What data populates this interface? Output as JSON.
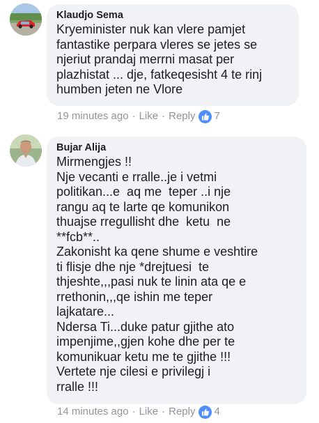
{
  "comments": [
    {
      "author": "Klaudjo Sema",
      "lines": [
        "Kryeminister nuk kan vlere pamjet",
        "fantastike perpara vleres se jetes se",
        "njeriut prandaj merrni masat per",
        "plazhistat ... dje, fatkeqesisht 4 te rinj",
        "humben jeten ne Vlore"
      ],
      "time": "19 minutes ago",
      "sep": "·",
      "like_label": "Like",
      "reply_label": "Reply",
      "reaction_icon": "thumbs-up-icon",
      "reaction_count": "7"
    },
    {
      "author": "Bujar Alija",
      "lines": [
        "Mirmengjes !!",
        "Nje vecanti e rralle..je i vetmi",
        "politikan...e  aq me  teper ..i nje",
        "rangu aq te larte qe komunikon",
        "thuajse rregullisht dhe  ketu  ne",
        "**fcb**..",
        "Zakonisht ka qene shume e veshtire",
        "ti flisje dhe nje *drejtuesi  te",
        "thjeshte,,,pasi nuk te linin ata qe e",
        "rrethonin,,,qe ishin me teper",
        "lajkatare...",
        "Ndersa Ti...duke patur gjithe ato",
        "impenjime,,gjen kohe dhe per te",
        "komunikuar ketu me te gjithe !!!",
        "Vertete nje cilesi e privilegj i",
        "rralle !!!"
      ],
      "time": "14 minutes ago",
      "sep": "·",
      "like_label": "Like",
      "reply_label": "Reply",
      "reaction_icon": "thumbs-up-icon",
      "reaction_count": "4"
    }
  ],
  "colors": {
    "bubble": "#f1f2f6",
    "text": "#1c1e21",
    "meta": "#90949c",
    "like_badge": "#4f8ff7"
  }
}
